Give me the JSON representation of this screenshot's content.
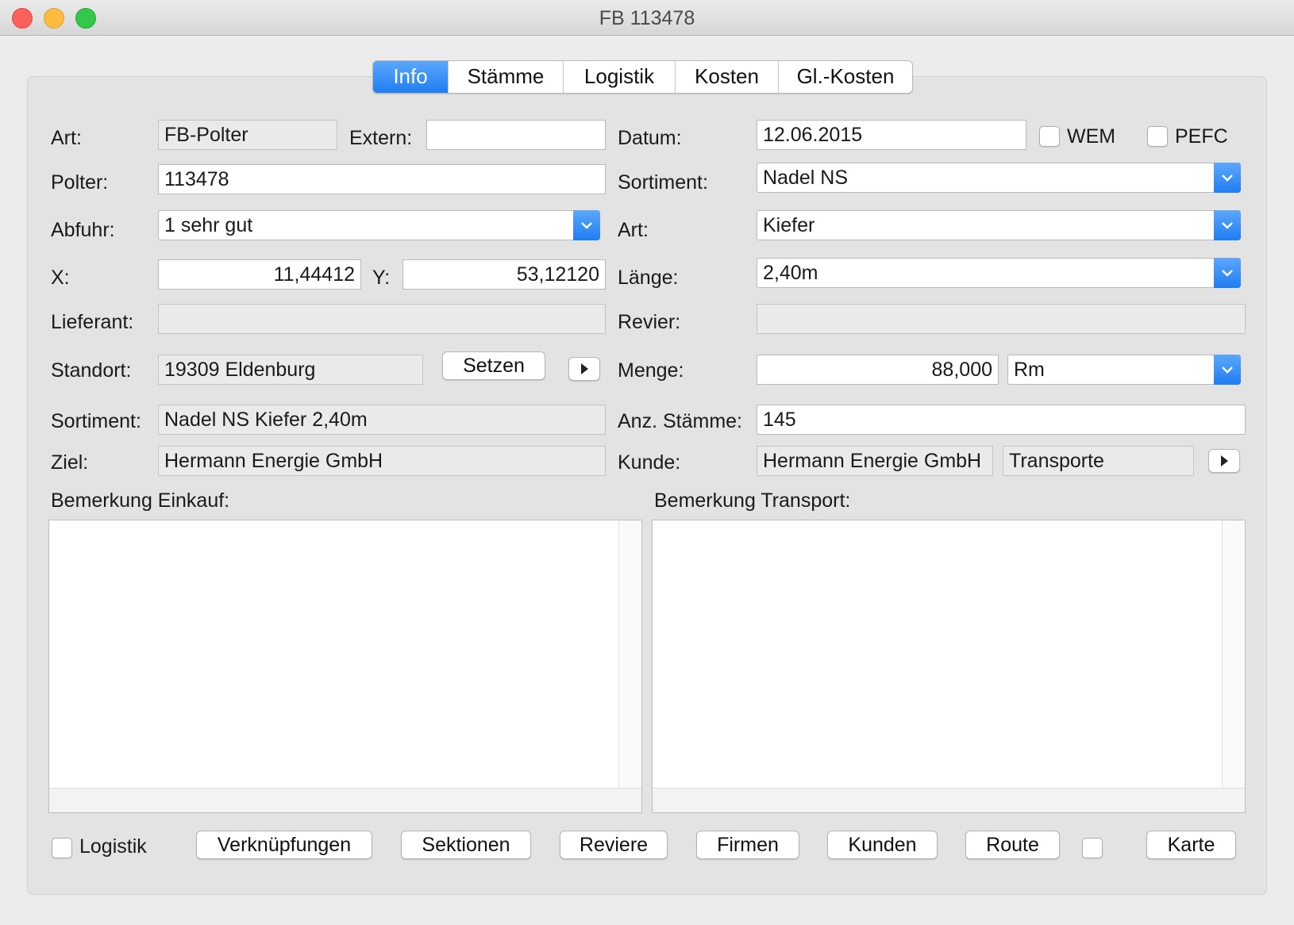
{
  "window": {
    "title": "FB 113478"
  },
  "tabs": [
    "Info",
    "Stämme",
    "Logistik",
    "Kosten",
    "Gl.-Kosten"
  ],
  "form": {
    "art_label": "Art:",
    "art_value": "FB-Polter",
    "extern_label": "Extern:",
    "extern_value": "",
    "datum_label": "Datum:",
    "datum_value": "12.06.2015",
    "wem_label": "WEM",
    "pefc_label": "PEFC",
    "polter_label": "Polter:",
    "polter_value": "113478",
    "sortiment_label": "Sortiment:",
    "sortiment_select": "Nadel NS",
    "abfuhr_label": "Abfuhr:",
    "abfuhr_value": "1 sehr gut",
    "art2_label": "Art:",
    "art2_value": "Kiefer",
    "x_label": "X:",
    "x_value": "11,44412",
    "y_label": "Y:",
    "y_value": "53,12120",
    "laenge_label": "Länge:",
    "laenge_value": "2,40m",
    "lieferant_label": "Lieferant:",
    "lieferant_value": "",
    "revier_label": "Revier:",
    "revier_value": "",
    "standort_label": "Standort:",
    "standort_value": "19309 Eldenburg",
    "setzen_label": "Setzen",
    "menge_label": "Menge:",
    "menge_value": "88,000",
    "menge_unit": "Rm",
    "sortiment2_label": "Sortiment:",
    "sortiment2_value": "Nadel NS Kiefer 2,40m",
    "anz_label": "Anz. Stämme:",
    "anz_value": "145",
    "ziel_label": "Ziel:",
    "ziel_value": "Hermann Energie GmbH",
    "kunde_label": "Kunde:",
    "kunde_value": "Hermann Energie GmbH",
    "kunde_extra": "Transporte",
    "bem_einkauf_label": "Bemerkung Einkauf:",
    "bem_transport_label": "Bemerkung Transport:"
  },
  "footer": {
    "logistik_label": "Logistik",
    "buttons": [
      "Verknüpfungen",
      "Sektionen",
      "Reviere",
      "Firmen",
      "Kunden",
      "Route",
      "Karte"
    ]
  },
  "colors": {
    "accent": "#2a85f5"
  }
}
